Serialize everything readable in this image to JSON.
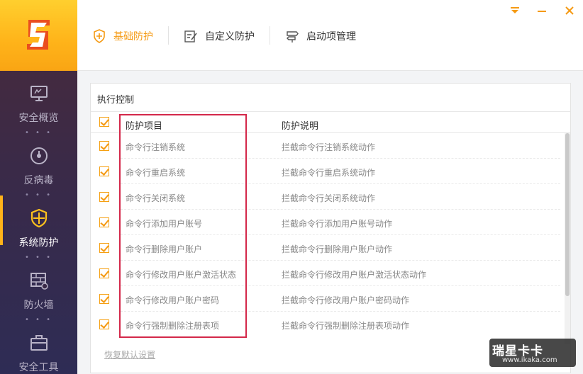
{
  "sidebar": {
    "items": [
      {
        "label": "安全概览",
        "icon": "monitor-icon"
      },
      {
        "label": "反病毒",
        "icon": "gauge-icon"
      },
      {
        "label": "系统防护",
        "icon": "shield-icon",
        "active": true
      },
      {
        "label": "防火墙",
        "icon": "firewall-icon"
      },
      {
        "label": "安全工具",
        "icon": "toolbox-icon"
      }
    ],
    "dots": "• • •"
  },
  "header": {
    "tabs": [
      {
        "label": "基础防护",
        "icon": "shield-plus-icon",
        "active": true
      },
      {
        "label": "自定义防护",
        "icon": "edit-doc-icon"
      },
      {
        "label": "启动项管理",
        "icon": "signpost-icon"
      }
    ]
  },
  "panel": {
    "title": "执行控制",
    "columns": [
      "防护项目",
      "防护说明"
    ],
    "rows": [
      {
        "item": "命令行注销系统",
        "desc": "拦截命令行注销系统动作",
        "checked": true
      },
      {
        "item": "命令行重启系统",
        "desc": "拦截命令行重启系统动作",
        "checked": true
      },
      {
        "item": "命令行关闭系统",
        "desc": "拦截命令行关闭系统动作",
        "checked": true
      },
      {
        "item": "命令行添加用户账号",
        "desc": "拦截命令行添加用户账号动作",
        "checked": true
      },
      {
        "item": "命令行删除用户账户",
        "desc": "拦截命令行删除用户账户动作",
        "checked": true
      },
      {
        "item": "命令行修改用户账户激活状态",
        "desc": "拦截命令行修改用户账户激活状态动作",
        "checked": true
      },
      {
        "item": "命令行修改用户账户密码",
        "desc": "拦截命令行修改用户账户密码动作",
        "checked": true
      },
      {
        "item": "命令行强制删除注册表项",
        "desc": "拦截命令行强制删除注册表项动作",
        "checked": true
      }
    ],
    "restore_label": "恢复默认设置"
  },
  "watermark": {
    "logo": "瑞星卡卡",
    "url": "www.ikaka.com"
  },
  "colors": {
    "accent": "#f59a13",
    "sidebar_top": "#4a2b3a",
    "sidebar_bottom": "#2e2c55",
    "highlight_box": "#d4284a"
  }
}
